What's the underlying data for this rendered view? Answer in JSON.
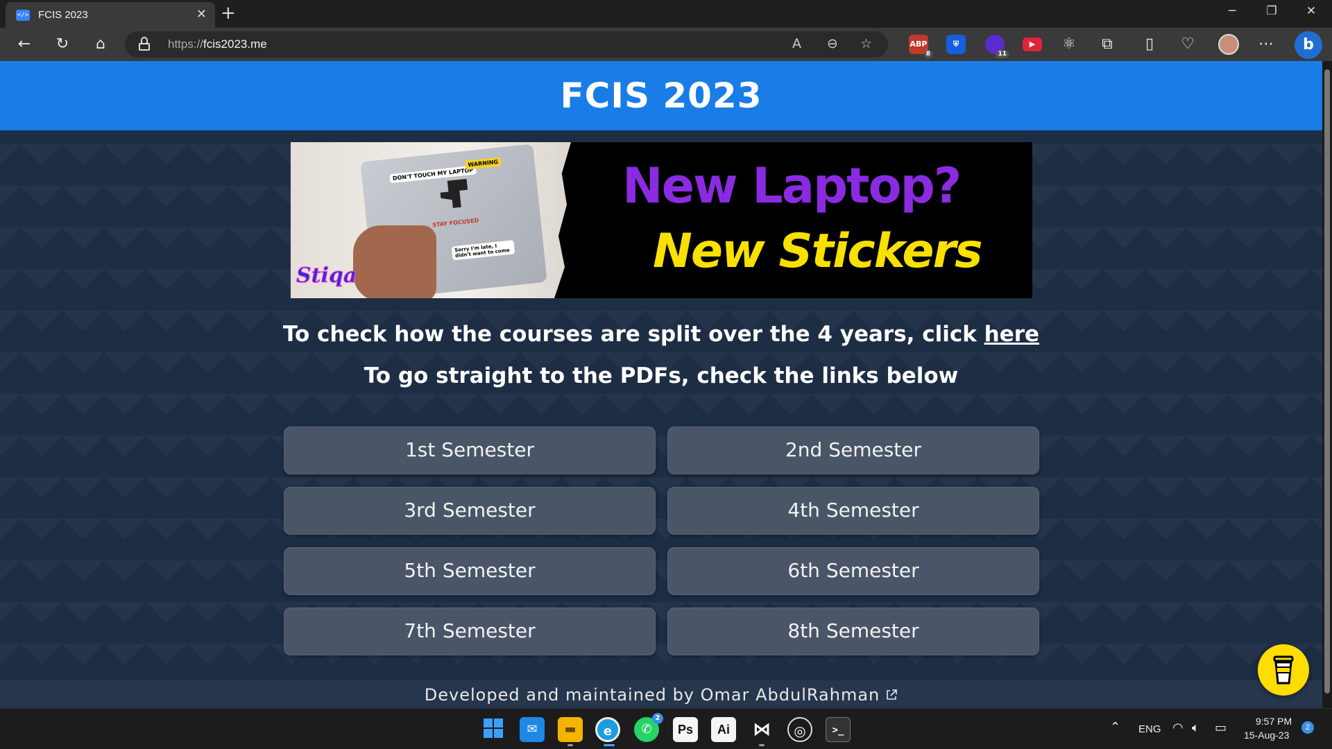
{
  "browser": {
    "tab_title": "FCIS 2023",
    "url_scheme": "https://",
    "url_host": "fcis2023.me",
    "extensions": [
      {
        "name": "adblock-plus",
        "label": "ABP",
        "badge": "8",
        "color": "#c0392b"
      },
      {
        "name": "bitwarden",
        "label": "",
        "badge": "",
        "color": "#175ddc"
      },
      {
        "name": "extension-purple",
        "label": "",
        "badge": "11",
        "color": "#5b2bd1"
      },
      {
        "name": "youtube-ext",
        "label": "",
        "badge": "",
        "color": "#e0243a"
      }
    ]
  },
  "site": {
    "title": "FCIS 2023",
    "banner": {
      "brand": "Stiqa",
      "line1": "New Laptop?",
      "line2": "New Stickers",
      "stickers": [
        "DON'T TOUCH MY LAPTOP",
        "WARNING",
        "STAY FOCUSED",
        "Sorry I'm late, I didn't want to come"
      ]
    },
    "courses_text": "To check how the courses are split over the 4 years, click ",
    "courses_link": "here",
    "pdfs_text": "To go straight to the PDFs, check the links below",
    "semesters": [
      "1st Semester",
      "2nd Semester",
      "3rd Semester",
      "4th Semester",
      "5th Semester",
      "6th Semester",
      "7th Semester",
      "8th Semester"
    ],
    "footer_text": "Developed and maintained by Omar AbdulRahman"
  },
  "taskbar": {
    "whatsapp_badge": "2",
    "photoshop_label": "Ps",
    "illustrator_label": "Ai",
    "language": "ENG",
    "time": "9:57 PM",
    "date": "15-Aug-23",
    "notification_count": "2"
  }
}
